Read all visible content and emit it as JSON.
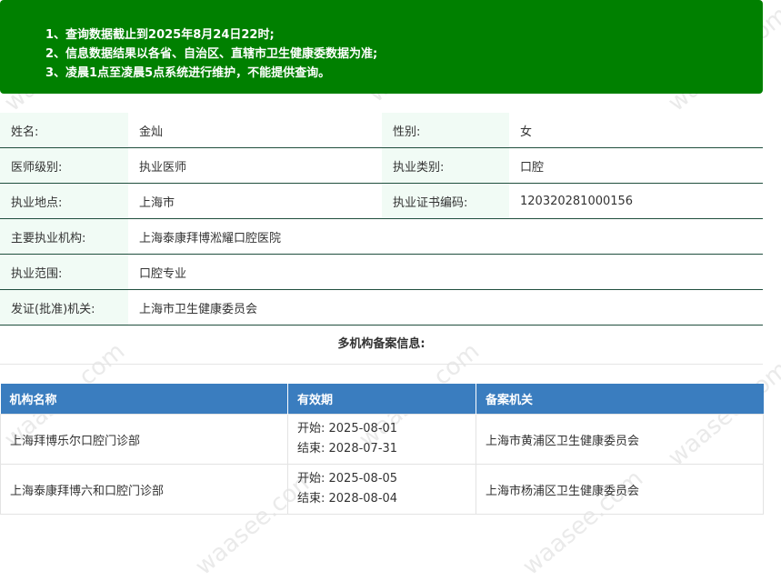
{
  "notice": {
    "line1": "1、查询数据截止到2025年8月24日22时;",
    "line2": "2、信息数据结果以各省、自治区、直辖市卫生健康委数据为准;",
    "line3": "3、凌晨1点至凌晨5点系统进行维护，不能提供查询。"
  },
  "info": {
    "name_label": "姓名:",
    "name_value": "金灿",
    "gender_label": "性别:",
    "gender_value": "女",
    "level_label": "医师级别:",
    "level_value": "执业医师",
    "category_label": "执业类别:",
    "category_value": "口腔",
    "location_label": "执业地点:",
    "location_value": "上海市",
    "cert_label": "执业证书编码:",
    "cert_value": "120320281000156",
    "org_label": "主要执业机构:",
    "org_value": "上海泰康拜博淞耀口腔医院",
    "scope_label": "执业范围:",
    "scope_value": "口腔专业",
    "issuer_label": "发证(批准)机关:",
    "issuer_value": "上海市卫生健康委员会"
  },
  "multi": {
    "title": "多机构备案信息:",
    "headers": [
      "机构名称",
      "有效期",
      "备案机关"
    ],
    "rows": [
      {
        "name": "上海拜博乐尔口腔门诊部",
        "start": "开始: 2025-08-01",
        "end": "结束: 2028-07-31",
        "authority": "上海市黄浦区卫生健康委员会"
      },
      {
        "name": "上海泰康拜博六和口腔门诊部",
        "start": "开始: 2025-08-05",
        "end": "结束: 2028-08-04",
        "authority": "上海市杨浦区卫生健康委员会"
      }
    ]
  },
  "watermark": {
    "text": "waasee.com"
  }
}
